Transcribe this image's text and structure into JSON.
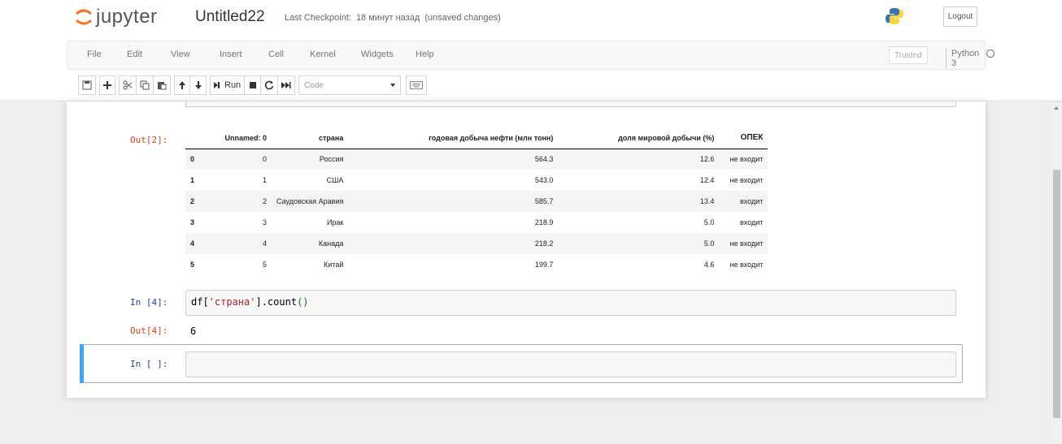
{
  "app": {
    "logo_text": "jupyter",
    "notebook_name": "Untitled22",
    "checkpoint_label": "Last Checkpoint:",
    "checkpoint_time": "18 минут назад",
    "save_status": "(unsaved changes)",
    "logout_label": "Logout"
  },
  "menu": {
    "items": [
      "File",
      "Edit",
      "View",
      "Insert",
      "Cell",
      "Kernel",
      "Widgets",
      "Help"
    ],
    "trusted_label": "Trusted",
    "kernel_name": "Python 3"
  },
  "toolbar": {
    "run_label": "Run",
    "cell_type": "Code",
    "icons": [
      "save-icon",
      "add-cell-icon",
      "cut-icon",
      "copy-icon",
      "paste-icon",
      "move-up-icon",
      "move-down-icon",
      "run-icon",
      "stop-icon",
      "restart-icon",
      "fast-forward-icon",
      "keyboard-icon"
    ]
  },
  "cells": {
    "out2": {
      "prompt": "Out[2]:",
      "table": {
        "columns": [
          "Unnamed: 0",
          "страна",
          "годовая добыча нефти (млн тонн)",
          "доля мировой добычи (%)",
          "ОПЕК"
        ],
        "rows": [
          {
            "index": "0",
            "values": [
              "0",
              "Россия",
              "564.3",
              "12.6",
              "не входит"
            ]
          },
          {
            "index": "1",
            "values": [
              "1",
              "США",
              "543.0",
              "12.4",
              "не входит"
            ]
          },
          {
            "index": "2",
            "values": [
              "2",
              "Саудовская Аравия",
              "585.7",
              "13.4",
              "входит"
            ]
          },
          {
            "index": "3",
            "values": [
              "3",
              "Ирак",
              "218.9",
              "5.0",
              "входит"
            ]
          },
          {
            "index": "4",
            "values": [
              "4",
              "Канада",
              "218.2",
              "5.0",
              "не входит"
            ]
          },
          {
            "index": "5",
            "values": [
              "5",
              "Китай",
              "199.7",
              "4.6",
              "не входит"
            ]
          }
        ]
      }
    },
    "in4": {
      "prompt": "In [4]:",
      "code_prefix": "df[",
      "code_string": "'страна'",
      "code_suffix": "].count",
      "code_parens": "()"
    },
    "out4": {
      "prompt": "Out[4]:",
      "value": "6"
    },
    "in_empty": {
      "prompt": "In [ ]:"
    }
  },
  "colors": {
    "accent_selected": "#42a5f5",
    "prompt_in": "#303f9f",
    "prompt_out": "#d84315",
    "string": "#ba2121",
    "paren": "#008000"
  }
}
